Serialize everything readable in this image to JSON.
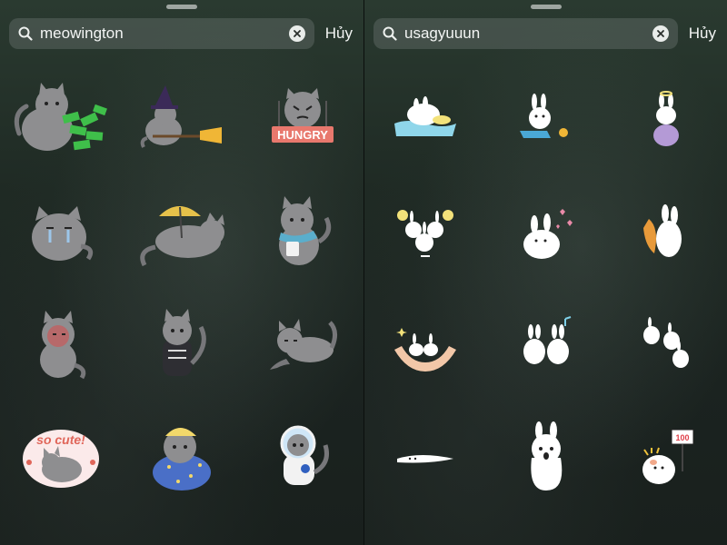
{
  "left": {
    "search": {
      "query": "meowington",
      "cancel_label": "Hủy"
    },
    "stickers": [
      {
        "icon": "cat-money-sticker"
      },
      {
        "icon": "cat-witch-broom-sticker"
      },
      {
        "icon": "cat-hungry-sticker",
        "caption": "HUNGRY"
      },
      {
        "icon": "cat-crying-sticker"
      },
      {
        "icon": "cat-umbrella-lying-sticker"
      },
      {
        "icon": "cat-scarf-mug-sticker"
      },
      {
        "icon": "cat-blushing-sticker"
      },
      {
        "icon": "cat-shirt-sitting-sticker"
      },
      {
        "icon": "cat-lying-back-sticker"
      },
      {
        "icon": "cat-so-cute-sticker",
        "caption": "so cute!"
      },
      {
        "icon": "cat-pajamas-sticker"
      },
      {
        "icon": "cat-astronaut-sticker"
      }
    ]
  },
  "right": {
    "search": {
      "query": "usagyuuun",
      "cancel_label": "Hủy"
    },
    "stickers": [
      {
        "icon": "rabbit-cloud-bath-sticker"
      },
      {
        "icon": "rabbit-laptop-sticker"
      },
      {
        "icon": "rabbit-stacked-sticker"
      },
      {
        "icon": "rabbit-cheerleaders-sticker"
      },
      {
        "icon": "rabbit-hearts-sticker"
      },
      {
        "icon": "rabbit-carrot-sticker"
      },
      {
        "icon": "rabbit-hands-holding-sticker"
      },
      {
        "icon": "rabbit-dancing-pair-sticker"
      },
      {
        "icon": "rabbit-floating-sticker"
      },
      {
        "icon": "rabbit-lying-flat-sticker"
      },
      {
        "icon": "rabbit-surprised-sticker"
      },
      {
        "icon": "rabbit-sign-sticker",
        "caption": "100"
      }
    ]
  },
  "colors": {
    "cat_gray": "#8e8e90",
    "money_green": "#3fbf4a",
    "hungry_red": "#e8786d",
    "rabbit_white": "#ffffff",
    "blanket_blue": "#4a6fc7"
  }
}
